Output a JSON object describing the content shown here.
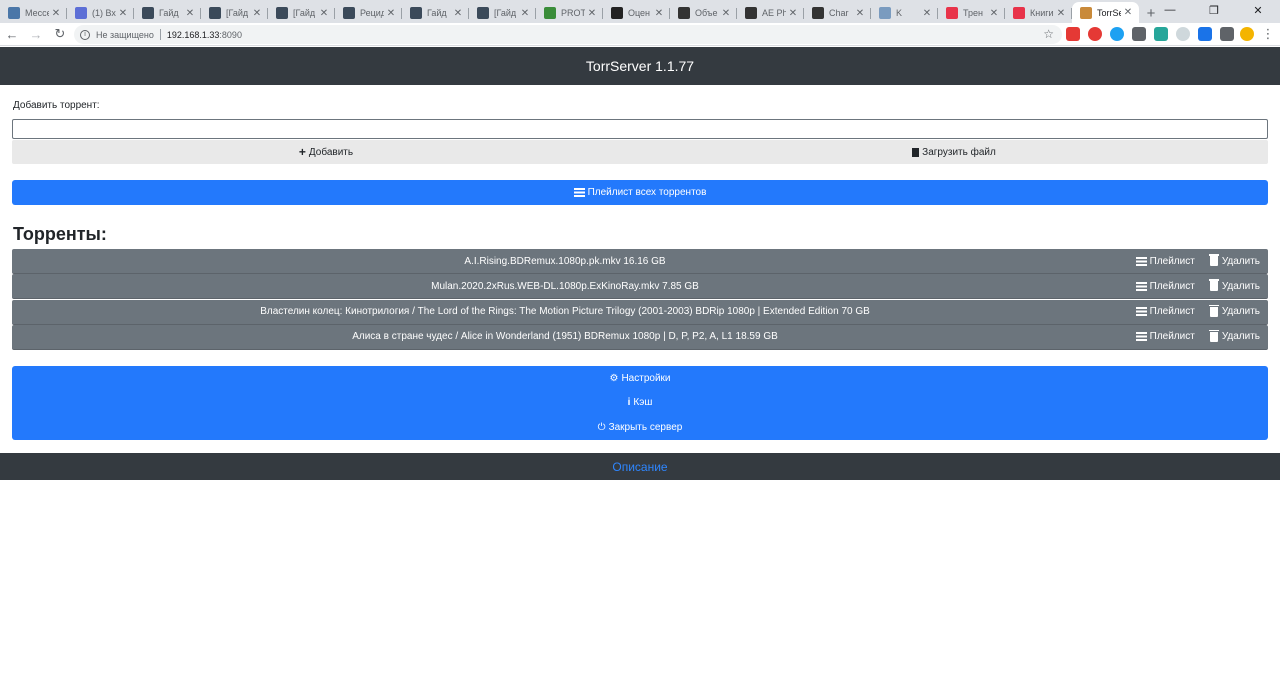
{
  "browser": {
    "tabs": [
      {
        "title": "Мессе",
        "color": "#4a76a8"
      },
      {
        "title": "(1) Вх",
        "color": "#5d6fd6"
      },
      {
        "title": "Гайд",
        "color": "#3b4a5a"
      },
      {
        "title": "[Гайд",
        "color": "#3b4a5a"
      },
      {
        "title": "[Гайд",
        "color": "#3b4a5a"
      },
      {
        "title": "Рецид",
        "color": "#3b4a5a"
      },
      {
        "title": "Гайд",
        "color": "#3b4a5a"
      },
      {
        "title": "[Гайд",
        "color": "#3b4a5a"
      },
      {
        "title": "PROT",
        "color": "#3a8d3a"
      },
      {
        "title": "Оцен",
        "color": "#222222"
      },
      {
        "title": "Объе",
        "color": "#333333"
      },
      {
        "title": "AE Ph",
        "color": "#333333"
      },
      {
        "title": "Char",
        "color": "#333333"
      },
      {
        "title": "K",
        "color": "#7a9bbf"
      },
      {
        "title": "Трен",
        "color": "#e8334a"
      },
      {
        "title": "Книги",
        "color": "#e8334a"
      }
    ],
    "active_tab": {
      "title": "TorrSe",
      "color": "#c98a3a"
    },
    "new_tab": "+",
    "address": {
      "security": "Не защищено",
      "host": "192.168.1.33",
      "port": ":8090"
    }
  },
  "header": {
    "title": "TorrServer 1.1.77"
  },
  "add": {
    "label": "Добавить торрент:",
    "input_value": "",
    "add_button": "Добавить",
    "upload_button": "Загрузить файл"
  },
  "playlist_all": "Плейлист всех торрентов",
  "torrents_title": "Торренты:",
  "torrents": [
    {
      "name": "A.I.Rising.BDRemux.1080p.pk.mkv 16.16 GB",
      "playlist": "Плейлист",
      "delete": "Удалить"
    },
    {
      "name": "Mulan.2020.2xRus.WEB-DL.1080p.ExKinoRay.mkv 7.85 GB",
      "playlist": "Плейлист",
      "delete": "Удалить"
    },
    {
      "name": "Властелин колец: Кинотрилогия / The Lord of the Rings: The Motion Picture Trilogy (2001-2003) BDRip 1080p | Extended Edition 70 GB",
      "playlist": "Плейлист",
      "delete": "Удалить"
    },
    {
      "name": "Алиса в стране чудес / Alice in Wonderland (1951) BDRemux 1080p | D, P, P2, A, L1 18.59 GB",
      "playlist": "Плейлист",
      "delete": "Удалить"
    }
  ],
  "bottom_menu": {
    "settings": "Настройки",
    "cache": "Кэш",
    "shutdown": "Закрыть сервер"
  },
  "footer": {
    "link": "Описание"
  },
  "colors": {
    "primary": "#2379fc",
    "dark": "#343a40",
    "secondary": "#6c757d"
  }
}
